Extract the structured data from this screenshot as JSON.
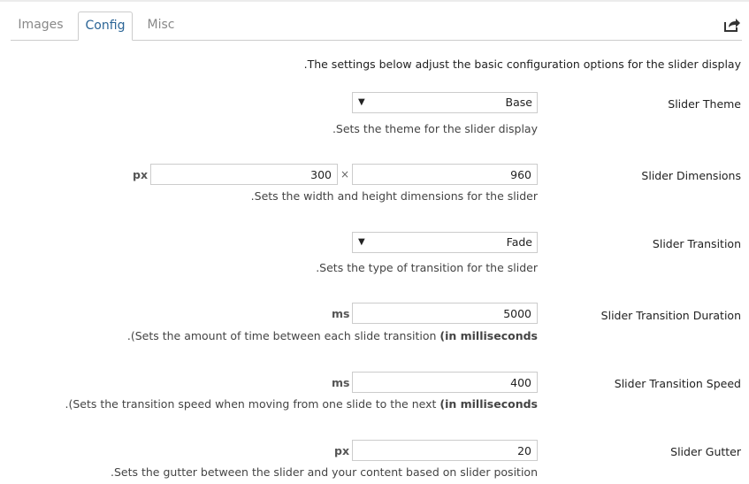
{
  "tabs": [
    {
      "label": "Images",
      "active": false
    },
    {
      "label": "Config",
      "active": true
    },
    {
      "label": "Misc",
      "active": false
    }
  ],
  "toolbar": {
    "share_icon": "share-arrow-icon"
  },
  "intro": ".The settings below adjust the basic configuration options for the slider display",
  "fields": {
    "theme": {
      "label": "Slider Theme",
      "value": "Base",
      "caret": "▼",
      "help": ".Sets the theme for the slider display"
    },
    "dimensions": {
      "label": "Slider Dimensions",
      "unit": "px",
      "height": "300",
      "separator": "×",
      "width": "960",
      "help": ".Sets the width and height dimensions for the slider"
    },
    "transition": {
      "label": "Slider Transition",
      "value": "Fade",
      "caret": "▼",
      "help": ".Sets the type of transition for the slider"
    },
    "duration": {
      "label": "Slider Transition Duration",
      "unit": "ms",
      "value": "5000",
      "help_main": ".(Sets the amount of time between each slide transition",
      "help_bold": "(in milliseconds"
    },
    "speed": {
      "label": "Slider Transition Speed",
      "unit": "ms",
      "value": "400",
      "help_main": ".(Sets the transition speed when moving from one slide to the next",
      "help_bold": "(in milliseconds"
    },
    "gutter": {
      "label": "Slider Gutter",
      "unit": "px",
      "value": "20",
      "help": ".Sets the gutter between the slider and your content based on slider position"
    }
  }
}
